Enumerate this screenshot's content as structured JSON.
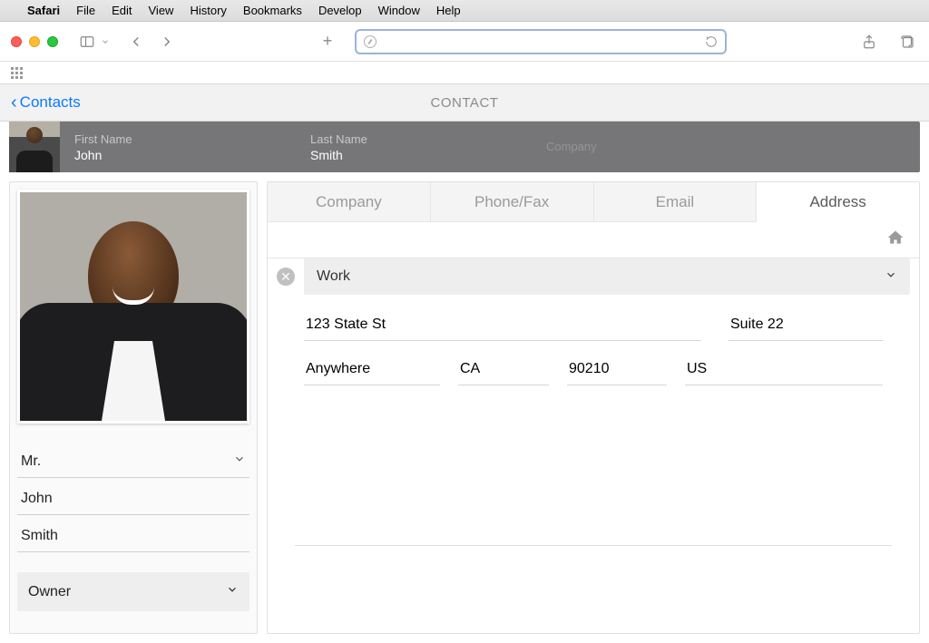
{
  "menubar": {
    "app": "Safari",
    "items": [
      "File",
      "Edit",
      "View",
      "History",
      "Bookmarks",
      "Develop",
      "Window",
      "Help"
    ]
  },
  "toolbar": {
    "url": "",
    "placeholder": ""
  },
  "appnav": {
    "back_label": "Contacts",
    "title": "CONTACT"
  },
  "band": {
    "first_name_label": "First Name",
    "first_name": "John",
    "last_name_label": "Last Name",
    "last_name": "Smith",
    "company_label": "Company",
    "company": ""
  },
  "left": {
    "prefix": "Mr.",
    "first_name": "John",
    "last_name": "Smith",
    "role": "Owner"
  },
  "tabs": {
    "items": [
      "Company",
      "Phone/Fax",
      "Email",
      "Address"
    ],
    "active_index": 3
  },
  "address": {
    "type": "Work",
    "street": "123 State St",
    "suite": "Suite 22",
    "city": "Anywhere",
    "state": "CA",
    "zip": "90210",
    "country": "US"
  }
}
